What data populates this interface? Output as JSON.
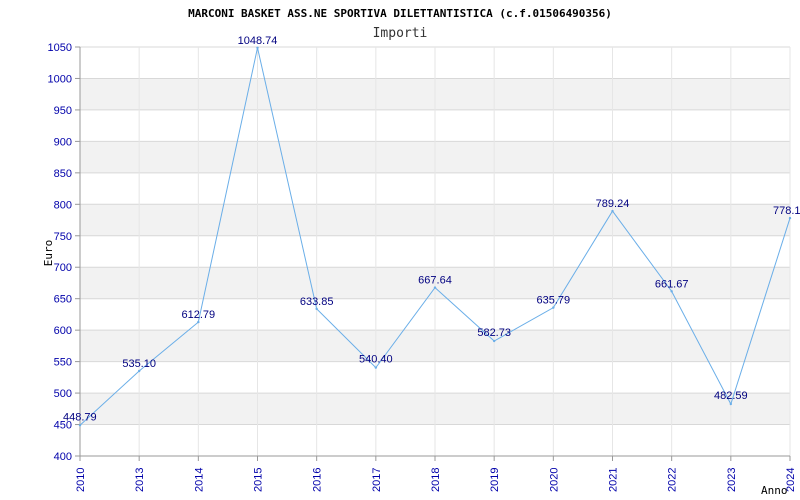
{
  "chart_data": {
    "type": "line",
    "title": "MARCONI BASKET ASS.NE SPORTIVA DILETTANTISTICA (c.f.01506490356)",
    "subtitle": "Importi",
    "xlabel": "Anno",
    "ylabel": "Euro",
    "categories": [
      "2010",
      "2013",
      "2014",
      "2015",
      "2016",
      "2017",
      "2018",
      "2019",
      "2020",
      "2021",
      "2022",
      "2023",
      "2024"
    ],
    "values": [
      448.79,
      535.1,
      612.79,
      1048.74,
      633.85,
      540.4,
      667.64,
      582.73,
      635.79,
      789.24,
      661.67,
      482.59,
      778.1
    ],
    "value_labels": [
      "448.79",
      "535.10",
      "612.79",
      "1048.74",
      "633.85",
      "540.40",
      "667.64",
      "582.73",
      "635.79",
      "789.24",
      "661.67",
      "482.59",
      "778.1"
    ],
    "ylim": [
      400,
      1050
    ],
    "yticks": [
      400,
      450,
      500,
      550,
      600,
      650,
      700,
      750,
      800,
      850,
      900,
      950,
      1000,
      1050
    ],
    "grid": true,
    "legend": "none",
    "colors": {
      "line": "#6aaee8",
      "band": "#f2f2f2",
      "grid": "#d8d8d8",
      "tick_text": "#0000aa",
      "label_text": "#000080"
    }
  }
}
